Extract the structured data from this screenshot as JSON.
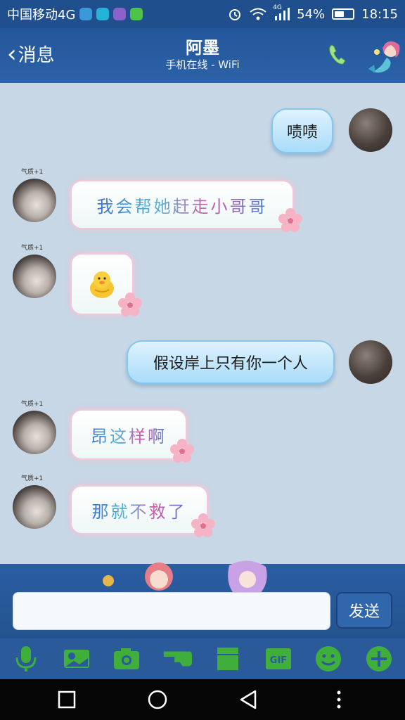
{
  "status_bar": {
    "carrier": "中国移动4G",
    "network": "4G",
    "battery": "54%",
    "battery_level": 0.54,
    "time": "18:15"
  },
  "header": {
    "back_label": "消息",
    "contact_name": "阿墨",
    "status": "手机在线 - WiFi"
  },
  "messages": [
    {
      "side": "right",
      "text": "啧啧"
    },
    {
      "side": "left",
      "text": "我会帮她赶走小哥哥",
      "badge": "气质+1"
    },
    {
      "side": "left",
      "emoji": "yellow-duck-emoji",
      "badge": "气质+1"
    },
    {
      "side": "right",
      "text": "假设岸上只有你一个人"
    },
    {
      "side": "left",
      "text": "昂这样啊",
      "badge": "气质+1"
    },
    {
      "side": "left",
      "text": "那就不救了",
      "badge": "气质+1"
    }
  ],
  "input": {
    "value": "",
    "send_label": "发送"
  },
  "toolbar": {
    "gif_label": "GIF"
  },
  "colors": {
    "accent": "#2a5da2",
    "chat_bg": "#c7d7e5",
    "icon_green": "#3fae3a"
  }
}
